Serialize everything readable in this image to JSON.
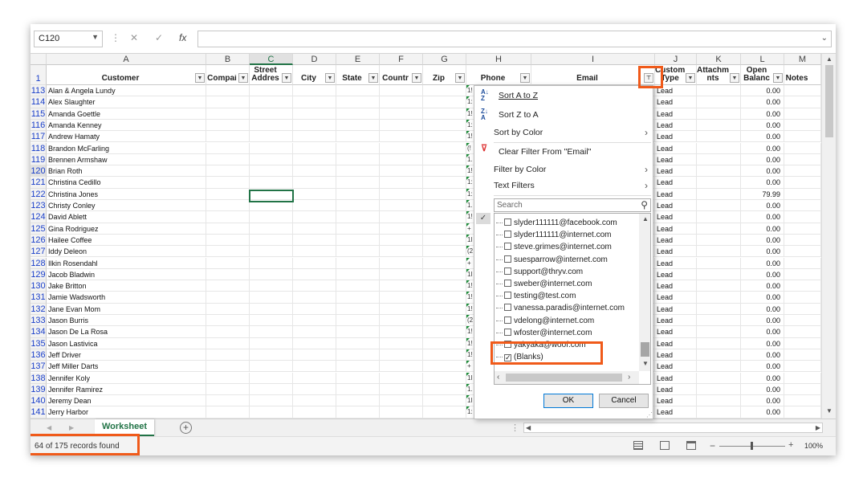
{
  "formula_bar": {
    "name_box": "C120",
    "fx": "fx",
    "formula": ""
  },
  "columns": [
    {
      "letter": "A",
      "header": "Customer"
    },
    {
      "letter": "B",
      "header": "Compai"
    },
    {
      "letter": "C",
      "header": "Street Addres"
    },
    {
      "letter": "D",
      "header": "City"
    },
    {
      "letter": "E",
      "header": "State"
    },
    {
      "letter": "F",
      "header": "Countr"
    },
    {
      "letter": "G",
      "header": "Zip"
    },
    {
      "letter": "H",
      "header": "Phone"
    },
    {
      "letter": "I",
      "header": "Email"
    },
    {
      "letter": "J",
      "header": "Customer Type"
    },
    {
      "letter": "K",
      "header": "Attachme nts"
    },
    {
      "letter": "L",
      "header": "Open Balanc"
    },
    {
      "letter": "M",
      "header": "Notes"
    }
  ],
  "header_row_number": "1",
  "rows": [
    {
      "n": "113",
      "customer": "Alan & Angela Lundy",
      "phone": "1!",
      "type": "Lead",
      "balance": "0.00"
    },
    {
      "n": "114",
      "customer": "Alex Slaughter",
      "phone": "1:",
      "type": "Lead",
      "balance": "0.00"
    },
    {
      "n": "115",
      "customer": "Amanda Goettle",
      "phone": "1!",
      "type": "Lead",
      "balance": "0.00"
    },
    {
      "n": "116",
      "customer": "Amanda Kenney",
      "phone": "1:",
      "type": "Lead",
      "balance": "0.00"
    },
    {
      "n": "117",
      "customer": "Andrew Hamaty",
      "phone": "1!",
      "type": "Lead",
      "balance": "0.00"
    },
    {
      "n": "118",
      "customer": "Brandon McFarling",
      "phone": "(!",
      "type": "Lead",
      "balance": "0.00"
    },
    {
      "n": "119",
      "customer": "Brennen Armshaw",
      "phone": "1.",
      "type": "Lead",
      "balance": "0.00"
    },
    {
      "n": "120",
      "customer": "Brian Roth",
      "phone": "1!",
      "type": "Lead",
      "balance": "0.00"
    },
    {
      "n": "121",
      "customer": "Christina Cedillo",
      "phone": "1:",
      "type": "Lead",
      "balance": "0.00"
    },
    {
      "n": "122",
      "customer": "Christina Jones",
      "phone": "1:",
      "type": "Lead",
      "balance": "79.99"
    },
    {
      "n": "123",
      "customer": "Christy Conley",
      "phone": "1.",
      "type": "Lead",
      "balance": "0.00"
    },
    {
      "n": "124",
      "customer": "David Ablett",
      "phone": "1!",
      "type": "Lead",
      "balance": "0.00"
    },
    {
      "n": "125",
      "customer": "Gina Rodriguez",
      "phone": "+",
      "type": "Lead",
      "balance": "0.00"
    },
    {
      "n": "126",
      "customer": "Hailee Coffee",
      "phone": "1l",
      "type": "Lead",
      "balance": "0.00"
    },
    {
      "n": "127",
      "customer": "Iddy Deleon",
      "phone": "(2",
      "type": "Lead",
      "balance": "0.00"
    },
    {
      "n": "128",
      "customer": "Ilkin Rosendahl",
      "phone": "+",
      "type": "Lead",
      "balance": "0.00"
    },
    {
      "n": "129",
      "customer": "Jacob Bladwin",
      "phone": "1l",
      "type": "Lead",
      "balance": "0.00"
    },
    {
      "n": "130",
      "customer": "Jake Britton",
      "phone": "1!",
      "type": "Lead",
      "balance": "0.00"
    },
    {
      "n": "131",
      "customer": "Jamie Wadsworth",
      "phone": "1!",
      "type": "Lead",
      "balance": "0.00"
    },
    {
      "n": "132",
      "customer": "Jane Evan Mom",
      "phone": "1!",
      "type": "Lead",
      "balance": "0.00"
    },
    {
      "n": "133",
      "customer": "Jason Burris",
      "phone": "(2",
      "type": "Lead",
      "balance": "0.00"
    },
    {
      "n": "134",
      "customer": "Jason De La Rosa",
      "phone": "1!",
      "type": "Lead",
      "balance": "0.00"
    },
    {
      "n": "135",
      "customer": "Jason Lastivica",
      "phone": "1!",
      "type": "Lead",
      "balance": "0.00"
    },
    {
      "n": "136",
      "customer": "Jeff Driver",
      "phone": "1!",
      "type": "Lead",
      "balance": "0.00"
    },
    {
      "n": "137",
      "customer": "Jeff Miller Darts",
      "phone": "+",
      "type": "Lead",
      "balance": "0.00"
    },
    {
      "n": "138",
      "customer": "Jennifer Koly",
      "phone": "1l",
      "type": "Lead",
      "balance": "0.00"
    },
    {
      "n": "139",
      "customer": "Jennifer Ramirez",
      "phone": "1.",
      "type": "Lead",
      "balance": "0.00"
    },
    {
      "n": "140",
      "customer": "Jeremy Dean",
      "phone": "1l",
      "type": "Lead",
      "balance": "0.00"
    },
    {
      "n": "141",
      "customer": "Jerry Harbor",
      "phone": "1:",
      "type": "Lead",
      "balance": "0.00"
    }
  ],
  "filter_menu": {
    "sort_asc": "Sort A to Z",
    "sort_desc": "Sort Z to A",
    "sort_by_color": "Sort by Color",
    "clear_filter": "Clear Filter From \"Email\"",
    "filter_by_color": "Filter by Color",
    "text_filters": "Text Filters",
    "search_placeholder": "Search",
    "items": [
      {
        "label": "slyder111111@facebook.com",
        "checked": false
      },
      {
        "label": "slyder111111@internet.com",
        "checked": false
      },
      {
        "label": "steve.grimes@internet.com",
        "checked": false
      },
      {
        "label": "suesparrow@internet.com",
        "checked": false
      },
      {
        "label": "support@thryv.com",
        "checked": false
      },
      {
        "label": "sweber@internet.com",
        "checked": false
      },
      {
        "label": "testing@test.com",
        "checked": false
      },
      {
        "label": "vanessa.paradis@internet.com",
        "checked": false
      },
      {
        "label": "vdelong@internet.com",
        "checked": false
      },
      {
        "label": "wfoster@internet.com",
        "checked": false
      },
      {
        "label": "yakyaka@woof.com",
        "checked": false
      },
      {
        "label": "(Blanks)",
        "checked": true
      }
    ],
    "ok": "OK",
    "cancel": "Cancel"
  },
  "sheet_tab": "Worksheet",
  "status": {
    "records": "64 of 175 records found",
    "zoom": "100%"
  },
  "colors": {
    "accent": "#217346",
    "highlight": "#f05a1a",
    "row_number": "#1a3fc9"
  }
}
